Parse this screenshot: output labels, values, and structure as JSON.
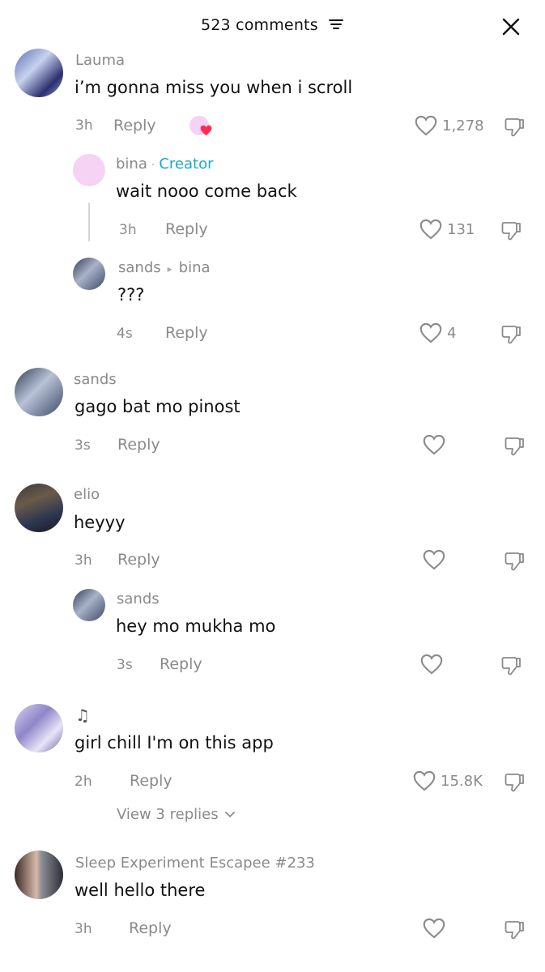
{
  "header": {
    "title": "523 comments"
  },
  "comments": [
    {
      "user": "Lauma",
      "text": "i’m gonna miss you when i scroll",
      "time": "3h",
      "reply": "Reply",
      "likes": "1,278"
    },
    {
      "user": "bina",
      "creator": "Creator",
      "text": "wait nooo come back",
      "time": "3h",
      "reply": "Reply",
      "likes": "131"
    },
    {
      "user": "sands",
      "reply_to": "bina",
      "text": "???",
      "time": "4s",
      "reply": "Reply",
      "likes": "4"
    },
    {
      "user": "sands",
      "text": "gago bat mo pinost",
      "time": "3s",
      "reply": "Reply"
    },
    {
      "user": "elio",
      "text": "heyyy",
      "time": "3h",
      "reply": "Reply"
    },
    {
      "user": "sands",
      "text": "hey mo mukha mo",
      "time": "3s",
      "reply": "Reply"
    },
    {
      "user": "♫",
      "text": "girl chill I'm on this app",
      "time": "2h",
      "reply": "Reply",
      "likes": "15.8K",
      "view_replies": "View 3 replies"
    },
    {
      "user": "Sleep Experiment Escapee #233",
      "text": "well hello there",
      "time": "3h",
      "reply": "Reply"
    }
  ],
  "icons": {
    "close": "close-icon",
    "filter": "filter-icon",
    "like": "heart-outline-icon",
    "dislike": "thumbs-down-icon",
    "creator_liked": "heart-badge-icon"
  },
  "colors": {
    "creator": "#1ba9c9",
    "heart_badge": "#fe2c55",
    "muted": "#8a8a8a"
  }
}
